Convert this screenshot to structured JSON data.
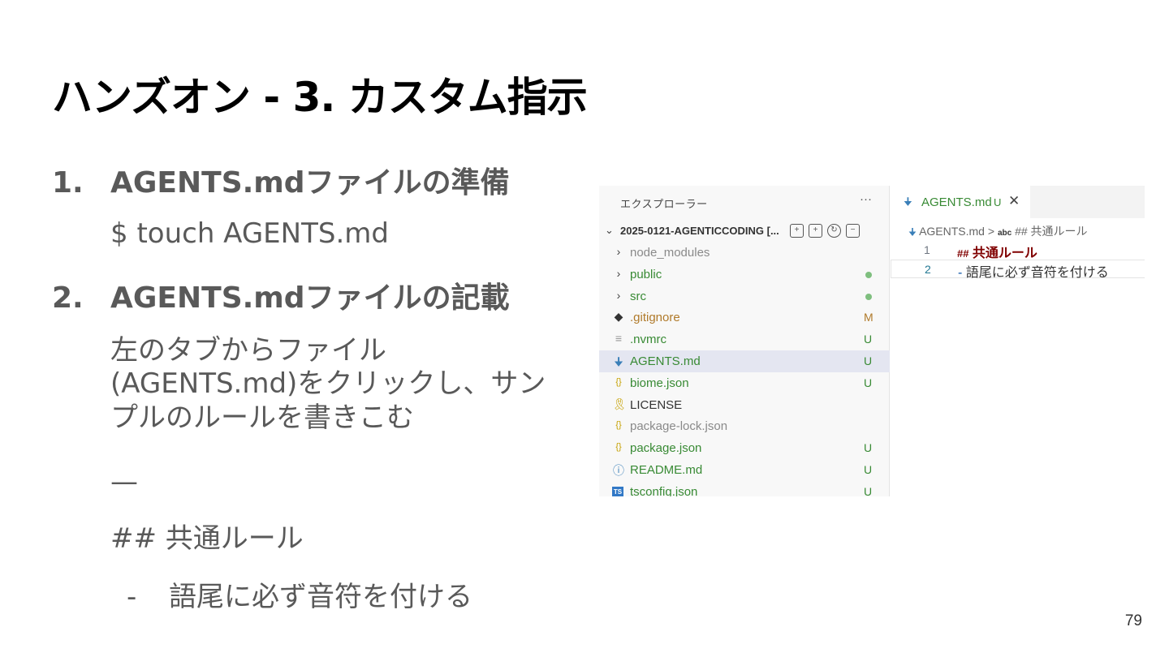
{
  "slide": {
    "title": "ハンズオン - 3. カスタム指示",
    "page_number": "79",
    "steps": [
      {
        "number": "1.",
        "title": "AGENTS.mdファイルの準備"
      },
      {
        "number": "2.",
        "title": "AGENTS.mdファイルの記載"
      }
    ],
    "command": "$ touch AGENTS.md",
    "description_lines": [
      "左のタブからファイル",
      "(AGENTS.md)をクリックし、サン",
      "プルのルールを書きこむ"
    ],
    "separator": "—",
    "rule_heading": "## 共通ルール",
    "rule_bullet": "-",
    "rule_text": "語尾に必ず音符を付ける"
  },
  "vscode": {
    "explorer": {
      "title": "エクスプローラー",
      "more": "···",
      "project": "2025-0121-AGENTICCODING [...",
      "items": [
        {
          "icon": "chevron-right-icon",
          "glyph": "›",
          "label": "node_modules",
          "status": "",
          "tone": "grey"
        },
        {
          "icon": "chevron-right-icon",
          "glyph": "›",
          "label": "public",
          "status": "•",
          "tone": "green"
        },
        {
          "icon": "chevron-right-icon",
          "glyph": "›",
          "label": "src",
          "status": "•",
          "tone": "green"
        },
        {
          "icon": "git-icon",
          "glyph": "◆",
          "label": ".gitignore",
          "status": "M",
          "tone": "orange"
        },
        {
          "icon": "lines-icon",
          "glyph": "≡",
          "label": ".nvmrc",
          "status": "U",
          "tone": "green"
        },
        {
          "icon": "markdown-icon",
          "glyph": "🠋",
          "label": "AGENTS.md",
          "status": "U",
          "tone": "green"
        },
        {
          "icon": "json-icon",
          "glyph": "{}",
          "label": "biome.json",
          "status": "U",
          "tone": "green"
        },
        {
          "icon": "license-icon",
          "glyph": "🎗",
          "label": "LICENSE",
          "status": "",
          "tone": "dark"
        },
        {
          "icon": "json-icon",
          "glyph": "{}",
          "label": "package-lock.json",
          "status": "",
          "tone": "grey"
        },
        {
          "icon": "json-icon",
          "glyph": "{}",
          "label": "package.json",
          "status": "U",
          "tone": "green"
        },
        {
          "icon": "info-icon",
          "glyph": "ⓘ",
          "label": "README.md",
          "status": "U",
          "tone": "green"
        },
        {
          "icon": "typescript-icon",
          "glyph": "TS",
          "label": "tsconfig.json",
          "status": "U",
          "tone": "green"
        }
      ]
    },
    "editor": {
      "tab_label": "AGENTS.md",
      "tab_status": "U",
      "tab_close": "✕",
      "breadcrumb_file": "AGENTS.md",
      "breadcrumb_sep": ">",
      "breadcrumb_symbol": "abc",
      "breadcrumb_heading": "## 共通ルール",
      "lines": [
        {
          "num": "1",
          "hash": "##",
          "text": "共通ルール"
        },
        {
          "num": "2",
          "hyphen": "-",
          "text": "語尾に必ず音符を付ける"
        }
      ]
    }
  }
}
